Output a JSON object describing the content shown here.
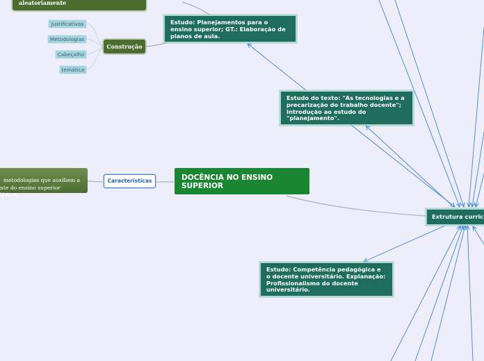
{
  "map": {
    "central": "DOCÊNCIA NO ENSINO SUPERIOR",
    "topics": {
      "estudo_planejamentos": "Estudo: Planejamentos para o ensino superior; GT.: Elaboração de planos de aula.",
      "estudo_tecnologias": "Estudo do texto: \"As tecnologias e a precarização do trabalho docente\"; Introdução ao estudo do \"planejamento\".",
      "extrutura": "Extrutura curric",
      "estudo_competencia": "Estudo: Competência pedagógica e o docente universitário. Explanação: Profissionalismo do docente universitário."
    },
    "construcao": {
      "label": "Construção",
      "tags": [
        "Justificativas",
        "Metodologias",
        "Cabeçalho",
        "temática"
      ]
    },
    "top_left_fragment": "aleatoriamente",
    "caracteristicas": "Características",
    "left_fragment": "metodologias que auxiliem a\nnte do ensino superior\nláticas."
  },
  "colors": {
    "background": "#eeeefb",
    "central": "#1b8631",
    "topic": "#1e6d5d",
    "olive": "#4c6d2f",
    "tag": "#a6d3e0",
    "connector_blue": "#3a85d6",
    "connector_gray": "#a7b0b8"
  }
}
